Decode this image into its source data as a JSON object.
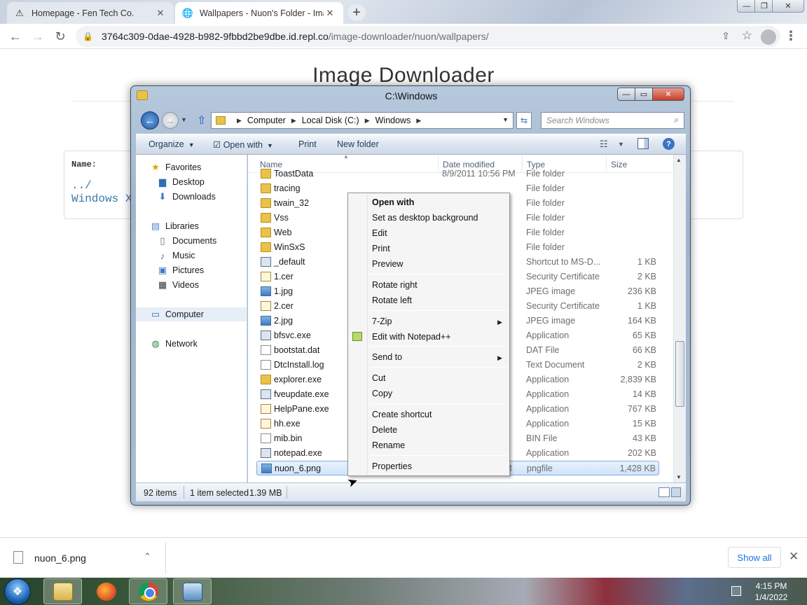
{
  "browser": {
    "tabs": [
      {
        "title": "Homepage - Fen Tech Co.",
        "icon": "warning-triangle-icon"
      },
      {
        "title": "Wallpapers - Nuon's Folder - Ima",
        "icon": "globe-icon"
      }
    ],
    "url_host": "3764c309-0dae-4928-b982-9fbbd2be9dbe.id.repl.co",
    "url_path": "/image-downloader/nuon/wallpapers/"
  },
  "webpage": {
    "heading": "Image Downloader",
    "name_label": "Name:",
    "entries": [
      "../",
      "Windows X"
    ]
  },
  "explorer": {
    "title": "C:\\Windows",
    "breadcrumbs": [
      "Computer",
      "Local Disk (C:)",
      "Windows"
    ],
    "search_placeholder": "Search Windows",
    "commands": [
      "Organize",
      "Open with",
      "Print",
      "New folder"
    ],
    "nav": {
      "favorites": "Favorites",
      "desktop": "Desktop",
      "downloads": "Downloads",
      "libraries": "Libraries",
      "documents": "Documents",
      "music": "Music",
      "pictures": "Pictures",
      "videos": "Videos",
      "computer": "Computer",
      "network": "Network"
    },
    "columns": [
      "Name",
      "Date modified",
      "Type",
      "Size"
    ],
    "files": [
      {
        "name": "ToastData",
        "date": "8/9/2011 10:56 PM",
        "type": "File folder",
        "size": "",
        "icon": "folder-icon"
      },
      {
        "name": "tracing",
        "date": "",
        "type": "File folder",
        "size": "",
        "icon": "folder-icon"
      },
      {
        "name": "twain_32",
        "date": "",
        "type": "File folder",
        "size": "",
        "icon": "folder-icon"
      },
      {
        "name": "Vss",
        "date": "",
        "type": "File folder",
        "size": "",
        "icon": "folder-icon"
      },
      {
        "name": "Web",
        "date": "",
        "type": "File folder",
        "size": "",
        "icon": "folder-icon"
      },
      {
        "name": "WinSxS",
        "date": "",
        "type": "File folder",
        "size": "",
        "icon": "folder-icon"
      },
      {
        "name": "_default",
        "date": "",
        "type": "Shortcut to MS-D...",
        "size": "1 KB",
        "icon": "shortcut-icon"
      },
      {
        "name": "1.cer",
        "date": "",
        "type": "Security Certificate",
        "size": "2 KB",
        "icon": "certificate-icon"
      },
      {
        "name": "1.jpg",
        "date": "",
        "type": "JPEG image",
        "size": "236 KB",
        "icon": "image-icon"
      },
      {
        "name": "2.cer",
        "date": "",
        "type": "Security Certificate",
        "size": "1 KB",
        "icon": "certificate-icon"
      },
      {
        "name": "2.jpg",
        "date": "",
        "type": "JPEG image",
        "size": "164 KB",
        "icon": "image-icon"
      },
      {
        "name": "bfsvc.exe",
        "date": "",
        "type": "Application",
        "size": "65 KB",
        "icon": "app-icon"
      },
      {
        "name": "bootstat.dat",
        "date": "",
        "type": "DAT File",
        "size": "66 KB",
        "icon": "document-icon"
      },
      {
        "name": "DtcInstall.log",
        "date": "",
        "type": "Text Document",
        "size": "2 KB",
        "icon": "document-icon"
      },
      {
        "name": "explorer.exe",
        "date": "",
        "type": "Application",
        "size": "2,839 KB",
        "icon": "explorer-app-icon"
      },
      {
        "name": "fveupdate.exe",
        "date": "",
        "type": "Application",
        "size": "14 KB",
        "icon": "app-icon"
      },
      {
        "name": "HelpPane.exe",
        "date": "",
        "type": "Application",
        "size": "767 KB",
        "icon": "help-app-icon"
      },
      {
        "name": "hh.exe",
        "date": "",
        "type": "Application",
        "size": "15 KB",
        "icon": "help-app-icon"
      },
      {
        "name": "mib.bin",
        "date": "",
        "type": "BIN File",
        "size": "43 KB",
        "icon": "document-icon"
      },
      {
        "name": "notepad.exe",
        "date": "",
        "type": "Application",
        "size": "202 KB",
        "icon": "notepad-icon"
      },
      {
        "name": "nuon_6.png",
        "date": "1/4/2022 4:15 PM",
        "type": "pngfile",
        "size": "1,428 KB",
        "icon": "image-icon"
      }
    ],
    "status": {
      "count": "92 items",
      "selected": "1 item selected",
      "size": "1.39 MB"
    }
  },
  "context_menu": {
    "items": [
      {
        "label": "Open with",
        "bold": true,
        "submenu": false
      },
      {
        "label": "Set as desktop background",
        "bold": false,
        "submenu": false
      },
      {
        "label": "Edit",
        "bold": false,
        "submenu": false
      },
      {
        "label": "Print",
        "bold": false,
        "submenu": false
      },
      {
        "label": "Preview",
        "bold": false,
        "submenu": false
      },
      {
        "label": "Rotate right",
        "bold": false,
        "submenu": false
      },
      {
        "label": "Rotate left",
        "bold": false,
        "submenu": false
      },
      {
        "label": "7-Zip",
        "bold": false,
        "submenu": true
      },
      {
        "label": "Edit with Notepad++",
        "bold": false,
        "submenu": false
      },
      {
        "label": "Send to",
        "bold": false,
        "submenu": true
      },
      {
        "label": "Cut",
        "bold": false,
        "submenu": false
      },
      {
        "label": "Copy",
        "bold": false,
        "submenu": false
      },
      {
        "label": "Create shortcut",
        "bold": false,
        "submenu": false
      },
      {
        "label": "Delete",
        "bold": false,
        "submenu": false
      },
      {
        "label": "Rename",
        "bold": false,
        "submenu": false
      },
      {
        "label": "Properties",
        "bold": false,
        "submenu": false
      }
    ]
  },
  "downloads": {
    "file": "nuon_6.png",
    "show_all": "Show all"
  },
  "taskbar": {
    "time": "4:15 PM",
    "date": "1/4/2022"
  }
}
